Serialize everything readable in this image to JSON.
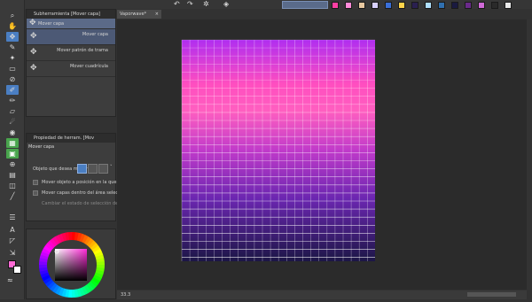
{
  "sub_tool_panel": {
    "tab_label": "Subherramienta [Mover capa]",
    "group_label": "Mover capa",
    "items": [
      "Mover capa",
      "Mover patrón de trama",
      "Mover cuadrícula"
    ]
  },
  "doc_tab": {
    "label": "Vaporwave*"
  },
  "properties_panel": {
    "tab_label": "Propiedad de herram. [Mov",
    "tool_title": "Mover capa",
    "target_label": "Objeto que desea mover",
    "options": [
      "Mover objeto a posición en la que se ha",
      "Mover capas dentro del área seleccionada",
      "Cambiar el estado de selección del objeto"
    ],
    "checked": [
      false,
      false,
      false
    ]
  },
  "status_bar": {
    "zoom": "33.3"
  },
  "colors": {
    "accent": "#4a7ec2",
    "grid_line": "#ffffff",
    "gradient_top": "#b02ef0",
    "gradient_pink": "#ff4ec0",
    "gradient_bottom": "#1c1646",
    "swatches": [
      "#ff3fa4",
      "#ff8bd8",
      "#e8c8a0",
      "#d8d0ff",
      "#3a6fd8",
      "#ffd44a",
      "#2a2050",
      "#b0e0ff",
      "#3070b0",
      "#1a1a40",
      "#6a2a8a",
      "#d06ad8",
      "#2a2a2a",
      "#e8e8e8"
    ]
  },
  "icons": {
    "move": "move-icon",
    "undo": "undo-icon",
    "redo": "redo-icon"
  }
}
